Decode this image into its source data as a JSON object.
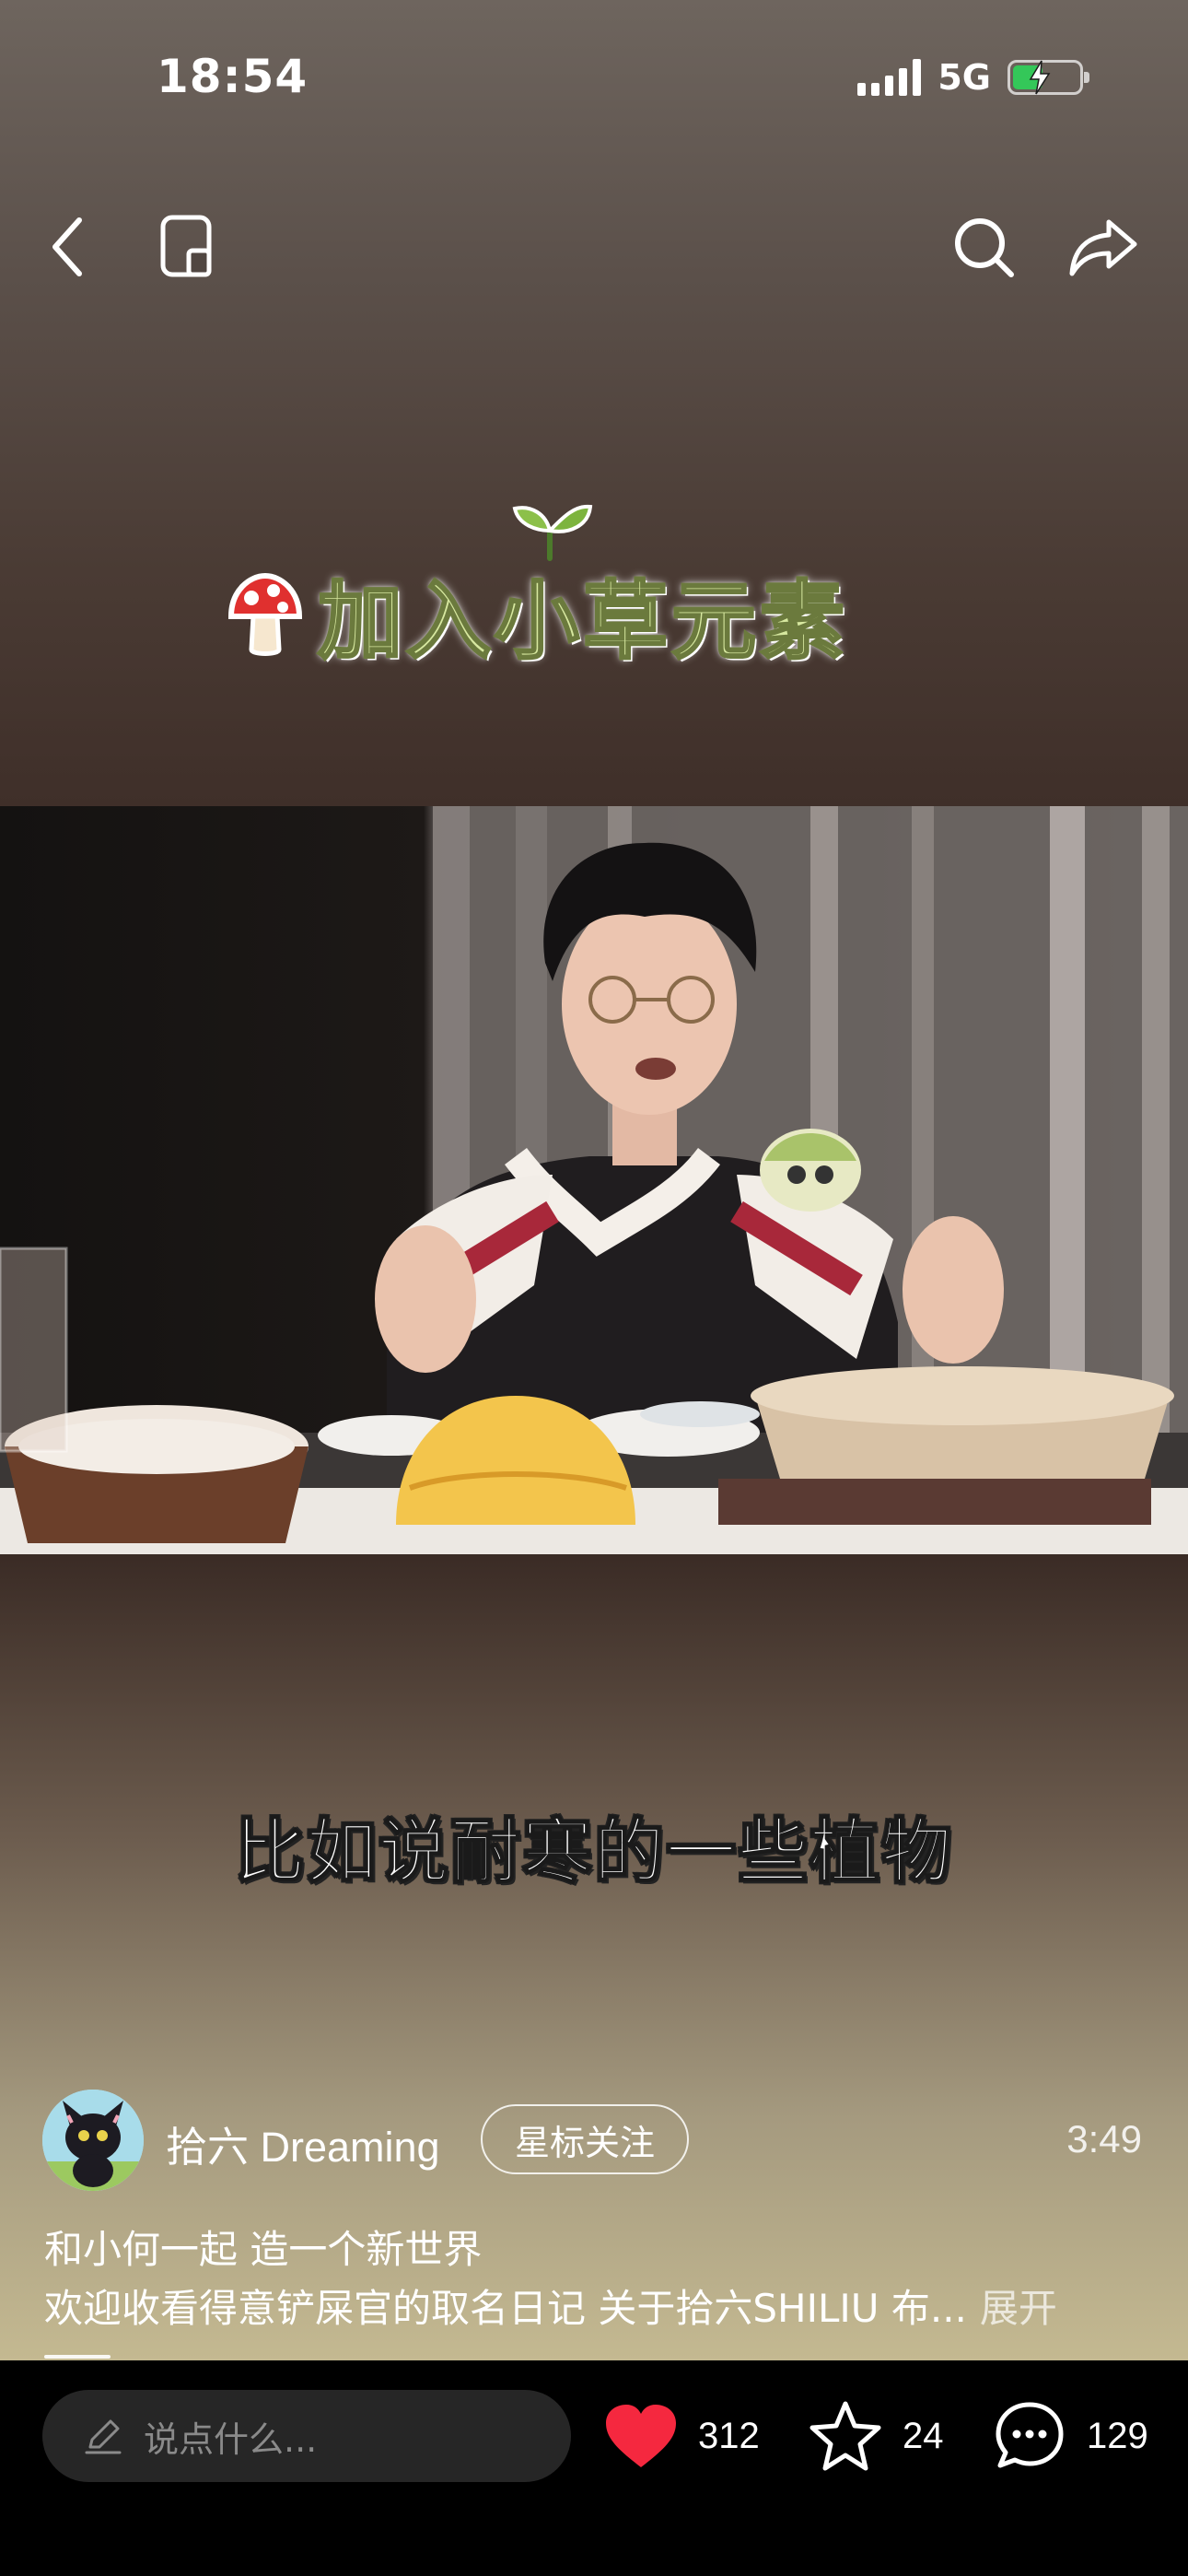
{
  "status_bar": {
    "time": "18:54",
    "network": "5G",
    "battery_level": 0.45,
    "battery_charging": true
  },
  "nav": {
    "back_icon": "chevron-left-icon",
    "pip_icon": "mini-window-icon",
    "search_icon": "search-icon",
    "share_icon": "share-icon"
  },
  "video": {
    "sticker_text": "加入小草元素",
    "subtitle": "比如说耐寒的一些植物",
    "duration": "3:49",
    "progress": 0.06
  },
  "author": {
    "name": "拾六 Dreaming",
    "follow_label": "星标关注"
  },
  "description": {
    "line1": "和小何一起 造一个新世界",
    "line2": "欢迎收看得意铲屎官的取名日记 关于拾六SHILIU 布...",
    "expand_label": "展开"
  },
  "bottom_bar": {
    "comment_placeholder": "说点什么...",
    "likes": "312",
    "favorites": "24",
    "comments": "129"
  },
  "colors": {
    "like": "#f5283f",
    "battery": "#34c759",
    "sticker": "#d7e8a0"
  }
}
